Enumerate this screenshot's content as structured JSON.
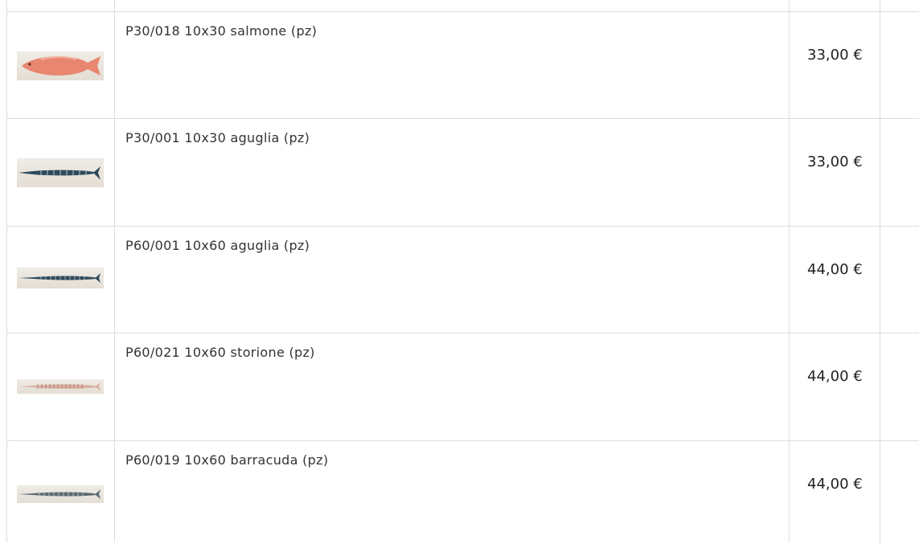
{
  "products": [
    {
      "name": "P30/018 10x30 salmone (pz)",
      "price": "33,00 €",
      "thumbnail_icon": "salmon-fish-tile-image",
      "fish_color": "#e8866f"
    },
    {
      "name": "P30/001 10x30 aguglia (pz)",
      "price": "33,00 €",
      "thumbnail_icon": "needlefish-tile-image",
      "fish_color": "#2f4a5a"
    },
    {
      "name": "P60/001 10x60 aguglia (pz)",
      "price": "44,00 €",
      "thumbnail_icon": "needlefish-tile-image",
      "fish_color": "#2f4a5a"
    },
    {
      "name": "P60/021 10x60 storione (pz)",
      "price": "44,00 €",
      "thumbnail_icon": "sturgeon-tile-image",
      "fish_color": "#b7806e"
    },
    {
      "name": "P60/019 10x60 barracuda (pz)",
      "price": "44,00 €",
      "thumbnail_icon": "barracuda-tile-image",
      "fish_color": "#5b6a72"
    }
  ]
}
